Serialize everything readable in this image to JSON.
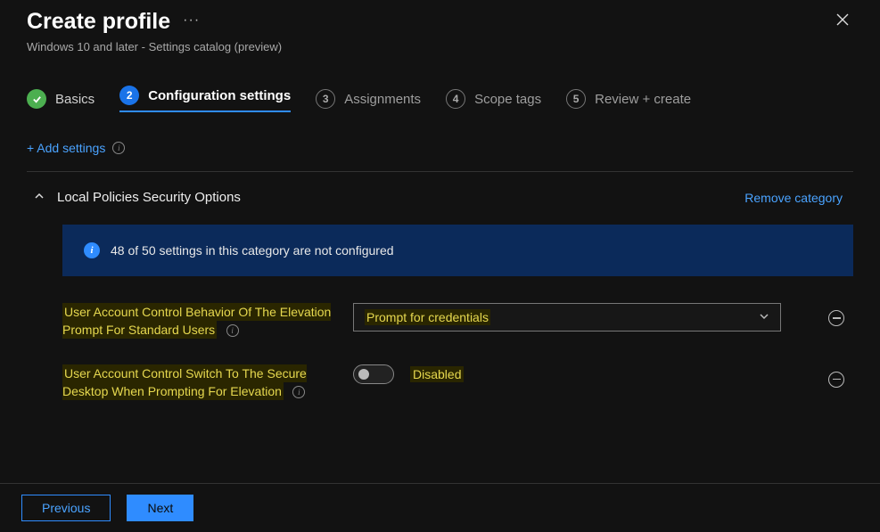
{
  "header": {
    "title": "Create profile",
    "subtitle": "Windows 10 and later - Settings catalog (preview)"
  },
  "wizard": {
    "steps": [
      {
        "label": "Basics",
        "state": "done"
      },
      {
        "label": "Configuration settings",
        "state": "active",
        "num": "2"
      },
      {
        "label": "Assignments",
        "state": "pending",
        "num": "3"
      },
      {
        "label": "Scope tags",
        "state": "pending",
        "num": "4"
      },
      {
        "label": "Review + create",
        "state": "pending",
        "num": "5"
      }
    ]
  },
  "add_settings": "+ Add settings",
  "category": {
    "title": "Local Policies Security Options",
    "remove": "Remove category",
    "banner": "48 of 50 settings in this category are not configured",
    "settings": [
      {
        "label": "User Account Control Behavior Of The Elevation Prompt For Standard Users",
        "type": "dropdown",
        "value": "Prompt for credentials"
      },
      {
        "label": "User Account Control Switch To The Secure Desktop When Prompting For Elevation",
        "type": "toggle",
        "value": "Disabled"
      }
    ]
  },
  "footer": {
    "previous": "Previous",
    "next": "Next"
  }
}
